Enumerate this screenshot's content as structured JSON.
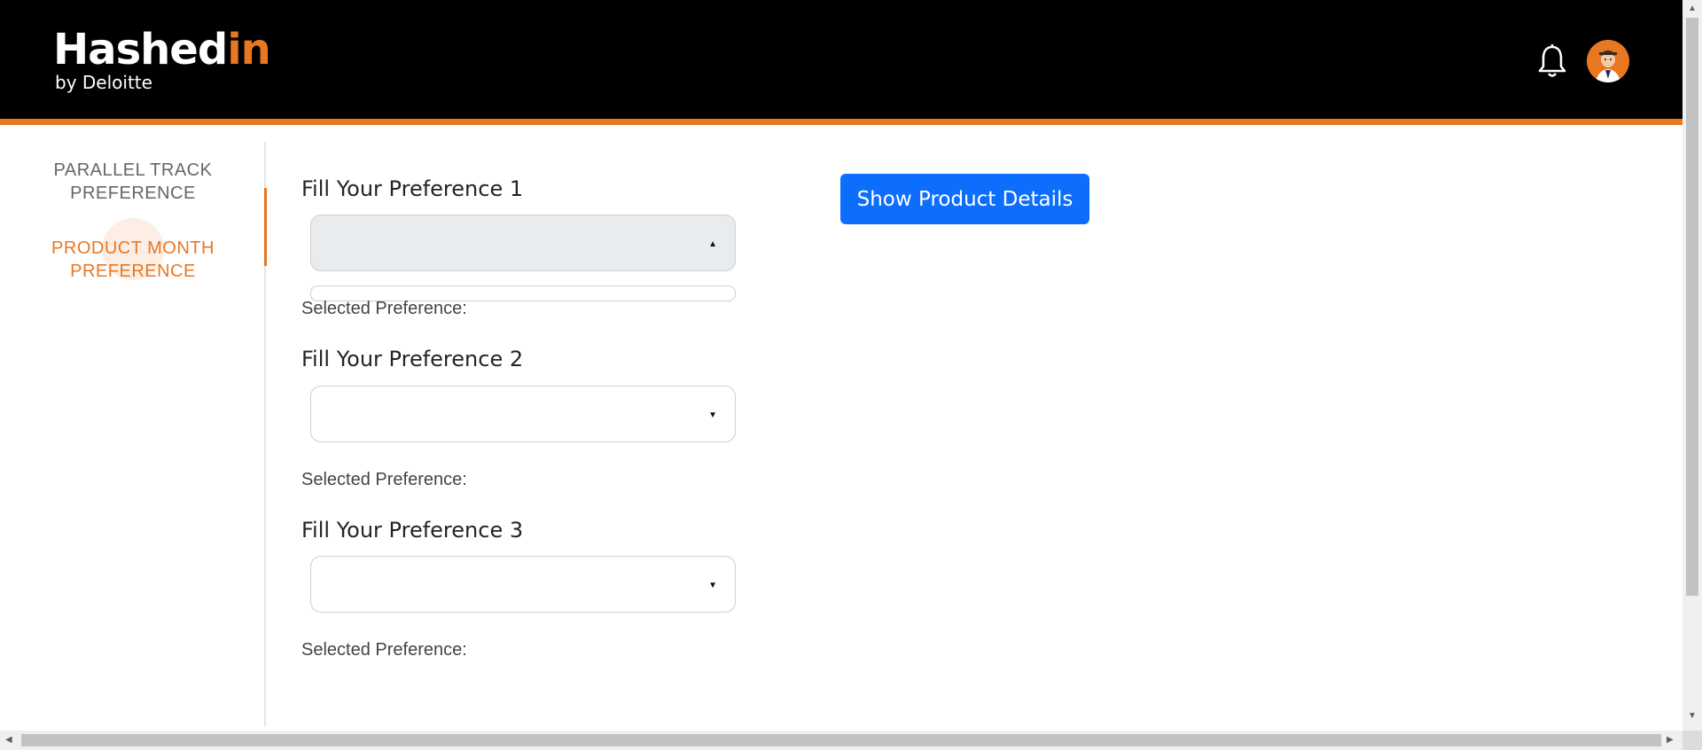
{
  "header": {
    "logo_text": "Hashed",
    "logo_accent": "in",
    "logo_sub": "by Deloitte",
    "icons": [
      "bell-icon",
      "avatar"
    ]
  },
  "sidebar": {
    "items": [
      {
        "label_line1": "PARALLEL TRACK",
        "label_line2": "PREFERENCE",
        "active": false
      },
      {
        "label_line1": "PRODUCT MONTH",
        "label_line2": "PREFERENCE",
        "active": true
      }
    ]
  },
  "form": {
    "preferences": [
      {
        "label": "Fill Your Preference 1",
        "value": "",
        "selected_label": "Selected Preference:",
        "open": true
      },
      {
        "label": "Fill Your Preference 2",
        "value": "",
        "selected_label": "Selected Preference:",
        "open": false
      },
      {
        "label": "Fill Your Preference 3",
        "value": "",
        "selected_label": "Selected Preference:",
        "open": false
      }
    ],
    "show_button": "Show Product Details"
  },
  "colors": {
    "accent": "#e87722",
    "header_bg": "#000000",
    "button": "#0d6efd"
  }
}
